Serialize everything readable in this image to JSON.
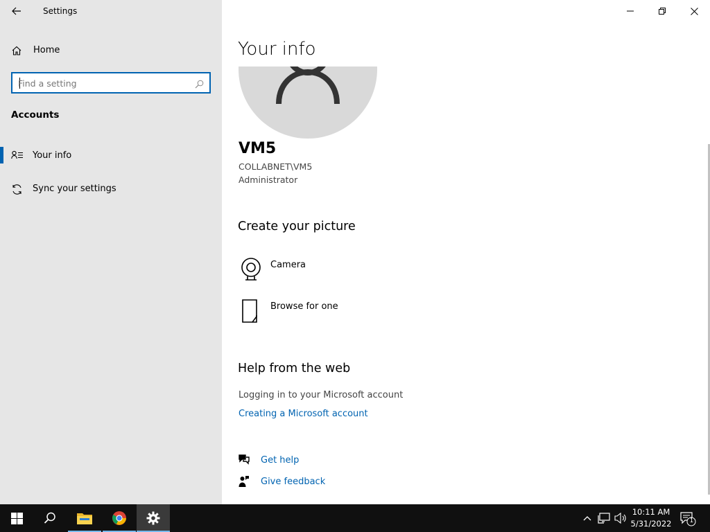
{
  "window": {
    "title": "Settings",
    "controls": {
      "minimize": "minimize",
      "restore": "restore",
      "close": "close"
    }
  },
  "sidebar": {
    "home_label": "Home",
    "search": {
      "value": "",
      "placeholder": "Find a setting"
    },
    "section_title": "Accounts",
    "items": [
      {
        "label": "Your info",
        "icon": "contact-card-icon",
        "active": true
      },
      {
        "label": "Sync your settings",
        "icon": "sync-icon",
        "active": false
      }
    ]
  },
  "main": {
    "page_title": "Your info",
    "user": {
      "name": "VM5",
      "domain": "COLLABNET\\VM5",
      "role": "Administrator"
    },
    "create_picture": {
      "heading": "Create your picture",
      "options": [
        {
          "label": "Camera",
          "icon": "camera-icon"
        },
        {
          "label": "Browse for one",
          "icon": "file-icon"
        }
      ]
    },
    "help_web": {
      "heading": "Help from the web",
      "text": "Logging in to your Microsoft account",
      "link": "Creating a Microsoft account"
    },
    "help_links": {
      "get_help": "Get help",
      "give_feedback": "Give feedback"
    }
  },
  "taskbar": {
    "time": "10:11 AM",
    "date": "5/31/2022",
    "notification_count": "1",
    "colors": {
      "background": "#101010",
      "accent": "#0063b1"
    }
  }
}
